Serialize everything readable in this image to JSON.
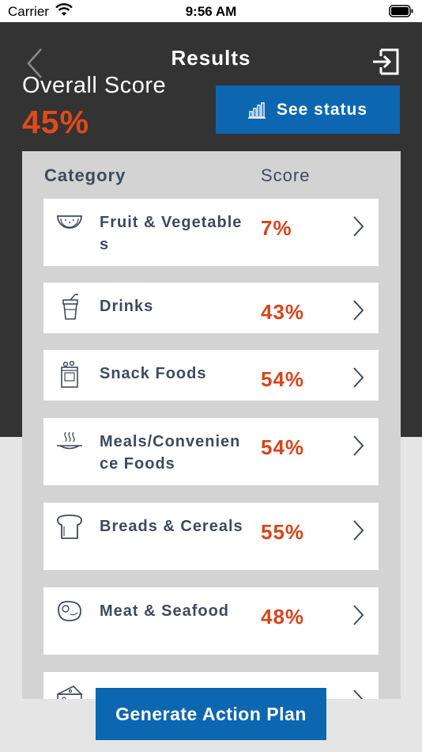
{
  "status_bar": {
    "carrier": "Carrier",
    "time": "9:56 AM"
  },
  "header": {
    "title": "Results",
    "overall_label": "Overall Score",
    "overall_value": "45%",
    "see_status_label": "See status"
  },
  "table": {
    "col_category": "Category",
    "col_score": "Score",
    "rows": [
      {
        "label": "Fruit & Vegetables",
        "score": "7%",
        "icon": "watermelon-icon"
      },
      {
        "label": "Drinks",
        "score": "43%",
        "icon": "drink-cup-icon"
      },
      {
        "label": "Snack Foods",
        "score": "54%",
        "icon": "snack-jar-icon"
      },
      {
        "label": "Meals/Convenience Foods",
        "score": "54%",
        "icon": "hot-plate-icon"
      },
      {
        "label": "Breads & Cereals",
        "score": "55%",
        "icon": "bread-icon"
      },
      {
        "label": "Meat & Seafood",
        "score": "48%",
        "icon": "steak-icon"
      },
      {
        "label": "",
        "score": "",
        "icon": "cheese-icon"
      }
    ]
  },
  "footer": {
    "generate_label": "Generate Action Plan"
  },
  "colors": {
    "accent_blue": "#0d67b0",
    "score_red": "#d6451a",
    "header_bg": "#333333"
  }
}
